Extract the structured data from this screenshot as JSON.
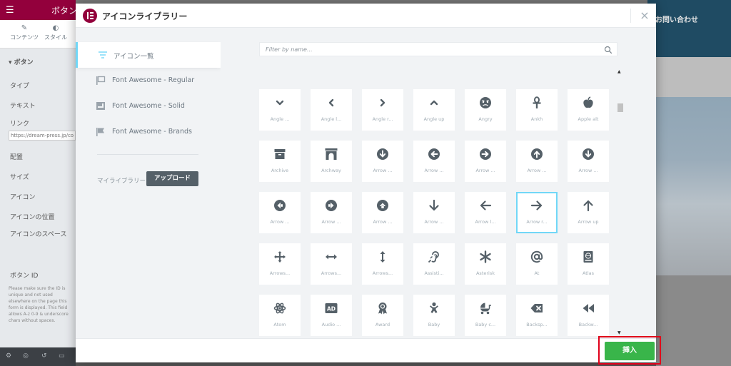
{
  "background": {
    "editor_title": "ボタン",
    "tabs": [
      "コンテンツ",
      "スタイル"
    ],
    "section_title": "ボタン",
    "rows": [
      "タイプ",
      "テキスト",
      "リンク",
      "配置",
      "サイズ",
      "アイコン",
      "アイコンの位置",
      "アイコンのスペース",
      "ボタン ID"
    ],
    "url_value": "https://dream-press.jp/co",
    "help_text": "Please make sure the ID is unique and not used elsewhere on the page this form is displayed. This field allows A-z 0-9 & underscore chars without spaces.",
    "hero_label": "お問い合わせ"
  },
  "modal": {
    "title": "アイコンライブラリー",
    "close_icon": "×",
    "sidebar": {
      "items": [
        {
          "label": "アイコン一覧",
          "icon": "list-icon",
          "active": true
        },
        {
          "label": "Font Awesome - Regular",
          "icon": "flag-regular-icon",
          "active": false
        },
        {
          "label": "Font Awesome - Solid",
          "icon": "flag-solid-icon",
          "active": false
        },
        {
          "label": "Font Awesome - Brands",
          "icon": "flag-brands-icon",
          "active": false
        }
      ],
      "library_label": "マイライブラリー",
      "upload_label": "アップロード"
    },
    "search": {
      "placeholder": "Filter by name..."
    },
    "icons": [
      {
        "label": "Angle ...",
        "icon": "angle-down-icon"
      },
      {
        "label": "Angle l...",
        "icon": "angle-left-icon"
      },
      {
        "label": "Angle r...",
        "icon": "angle-right-icon"
      },
      {
        "label": "Angle up",
        "icon": "angle-up-icon"
      },
      {
        "label": "Angry",
        "icon": "angry-icon"
      },
      {
        "label": "Ankh",
        "icon": "ankh-icon"
      },
      {
        "label": "Apple alt",
        "icon": "apple-alt-icon"
      },
      {
        "label": "Archive",
        "icon": "archive-icon"
      },
      {
        "label": "Archway",
        "icon": "archway-icon"
      },
      {
        "label": "Arrow ...",
        "icon": "arrow-circle-down-icon"
      },
      {
        "label": "Arrow ...",
        "icon": "arrow-circle-left-icon"
      },
      {
        "label": "Arrow ...",
        "icon": "arrow-circle-right-icon"
      },
      {
        "label": "Arrow ...",
        "icon": "arrow-circle-up-icon"
      },
      {
        "label": "Arrow ...",
        "icon": "arrow-circle-down-2-icon"
      },
      {
        "label": "Arrow ...",
        "icon": "arrow-alt-circle-left-icon"
      },
      {
        "label": "Arrow ...",
        "icon": "arrow-alt-circle-right-icon"
      },
      {
        "label": "Arrow ...",
        "icon": "arrow-alt-circle-up-icon"
      },
      {
        "label": "Arrow ...",
        "icon": "arrow-down-icon"
      },
      {
        "label": "Arrow l...",
        "icon": "arrow-left-icon"
      },
      {
        "label": "Arrow r...",
        "icon": "arrow-right-icon",
        "selected": true
      },
      {
        "label": "Arrow up",
        "icon": "arrow-up-icon"
      },
      {
        "label": "Arrows...",
        "icon": "arrows-alt-icon"
      },
      {
        "label": "Arrows...",
        "icon": "arrows-alt-h-icon"
      },
      {
        "label": "Arrows...",
        "icon": "arrows-alt-v-icon"
      },
      {
        "label": "Assisti...",
        "icon": "assistive-listening-icon"
      },
      {
        "label": "Asterisk",
        "icon": "asterisk-icon"
      },
      {
        "label": "At",
        "icon": "at-icon"
      },
      {
        "label": "Atlas",
        "icon": "atlas-icon"
      },
      {
        "label": "Atom",
        "icon": "atom-icon"
      },
      {
        "label": "Audio ...",
        "icon": "audio-description-icon"
      },
      {
        "label": "Award",
        "icon": "award-icon"
      },
      {
        "label": "Baby",
        "icon": "baby-icon"
      },
      {
        "label": "Baby c...",
        "icon": "baby-carriage-icon"
      },
      {
        "label": "Backsp...",
        "icon": "backspace-icon"
      },
      {
        "label": "Backw...",
        "icon": "backward-icon"
      }
    ],
    "footer": {
      "insert_label": "挿入"
    }
  },
  "colors": {
    "brand": "#92003b",
    "accent": "#71d7f7",
    "insert": "#39b54a",
    "highlight_box": "#e0001a"
  }
}
